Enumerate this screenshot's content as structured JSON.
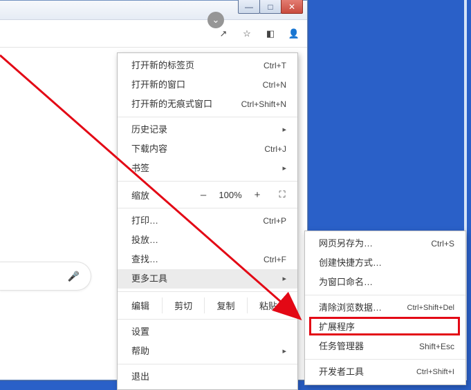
{
  "window": {
    "min": "—",
    "max": "□",
    "close": "✕"
  },
  "toolbar": {
    "collapse_glyph": "⌄",
    "share_glyph": "↗",
    "star_glyph": "☆",
    "panel_glyph": "◧",
    "profile_glyph": "👤",
    "menu_glyph": "⋮"
  },
  "search": {
    "mic_glyph": "🎤"
  },
  "menu": {
    "new_tab": "打开新的标签页",
    "new_tab_sc": "Ctrl+T",
    "new_win": "打开新的窗口",
    "new_win_sc": "Ctrl+N",
    "incognito": "打开新的无痕式窗口",
    "incognito_sc": "Ctrl+Shift+N",
    "history": "历史记录",
    "downloads": "下载内容",
    "downloads_sc": "Ctrl+J",
    "bookmarks": "书签",
    "zoom_label": "缩放",
    "zoom_minus": "–",
    "zoom_val": "100%",
    "zoom_plus": "+",
    "zoom_full": "⛶",
    "print": "打印…",
    "print_sc": "Ctrl+P",
    "cast": "投放…",
    "find": "查找…",
    "find_sc": "Ctrl+F",
    "more_tools": "更多工具",
    "edit_label": "编辑",
    "cut": "剪切",
    "copy": "复制",
    "paste": "粘贴",
    "settings": "设置",
    "help": "帮助",
    "exit": "退出"
  },
  "submenu": {
    "save_as": "网页另存为…",
    "save_as_sc": "Ctrl+S",
    "shortcut": "创建快捷方式…",
    "name_window": "为窗口命名…",
    "clear_data": "清除浏览数据…",
    "clear_data_sc": "Ctrl+Shift+Del",
    "extensions": "扩展程序",
    "task_manager": "任务管理器",
    "task_manager_sc": "Shift+Esc",
    "dev_tools": "开发者工具",
    "dev_tools_sc": "Ctrl+Shift+I"
  }
}
